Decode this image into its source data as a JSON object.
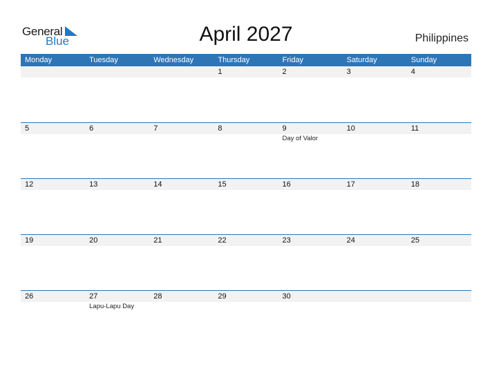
{
  "logo": {
    "word1": "General",
    "word2": "Blue",
    "icon": "triangle-flag-icon"
  },
  "title": "April 2027",
  "country": "Philippines",
  "colors": {
    "accent": "#2e75b6",
    "logo_blue": "#1f79c8",
    "day_strip": "#f2f2f2"
  },
  "weekdays": [
    "Monday",
    "Tuesday",
    "Wednesday",
    "Thursday",
    "Friday",
    "Saturday",
    "Sunday"
  ],
  "weeks": [
    {
      "days": [
        "",
        "",
        "",
        "1",
        "2",
        "3",
        "4"
      ],
      "events": [
        "",
        "",
        "",
        "",
        "",
        "",
        ""
      ]
    },
    {
      "days": [
        "5",
        "6",
        "7",
        "8",
        "9",
        "10",
        "11"
      ],
      "events": [
        "",
        "",
        "",
        "",
        "Day of Valor",
        "",
        ""
      ]
    },
    {
      "days": [
        "12",
        "13",
        "14",
        "15",
        "16",
        "17",
        "18"
      ],
      "events": [
        "",
        "",
        "",
        "",
        "",
        "",
        ""
      ]
    },
    {
      "days": [
        "19",
        "20",
        "21",
        "22",
        "23",
        "24",
        "25"
      ],
      "events": [
        "",
        "",
        "",
        "",
        "",
        "",
        ""
      ]
    },
    {
      "days": [
        "26",
        "27",
        "28",
        "29",
        "30",
        "",
        ""
      ],
      "events": [
        "",
        "Lapu-Lapu Day",
        "",
        "",
        "",
        "",
        ""
      ]
    }
  ]
}
